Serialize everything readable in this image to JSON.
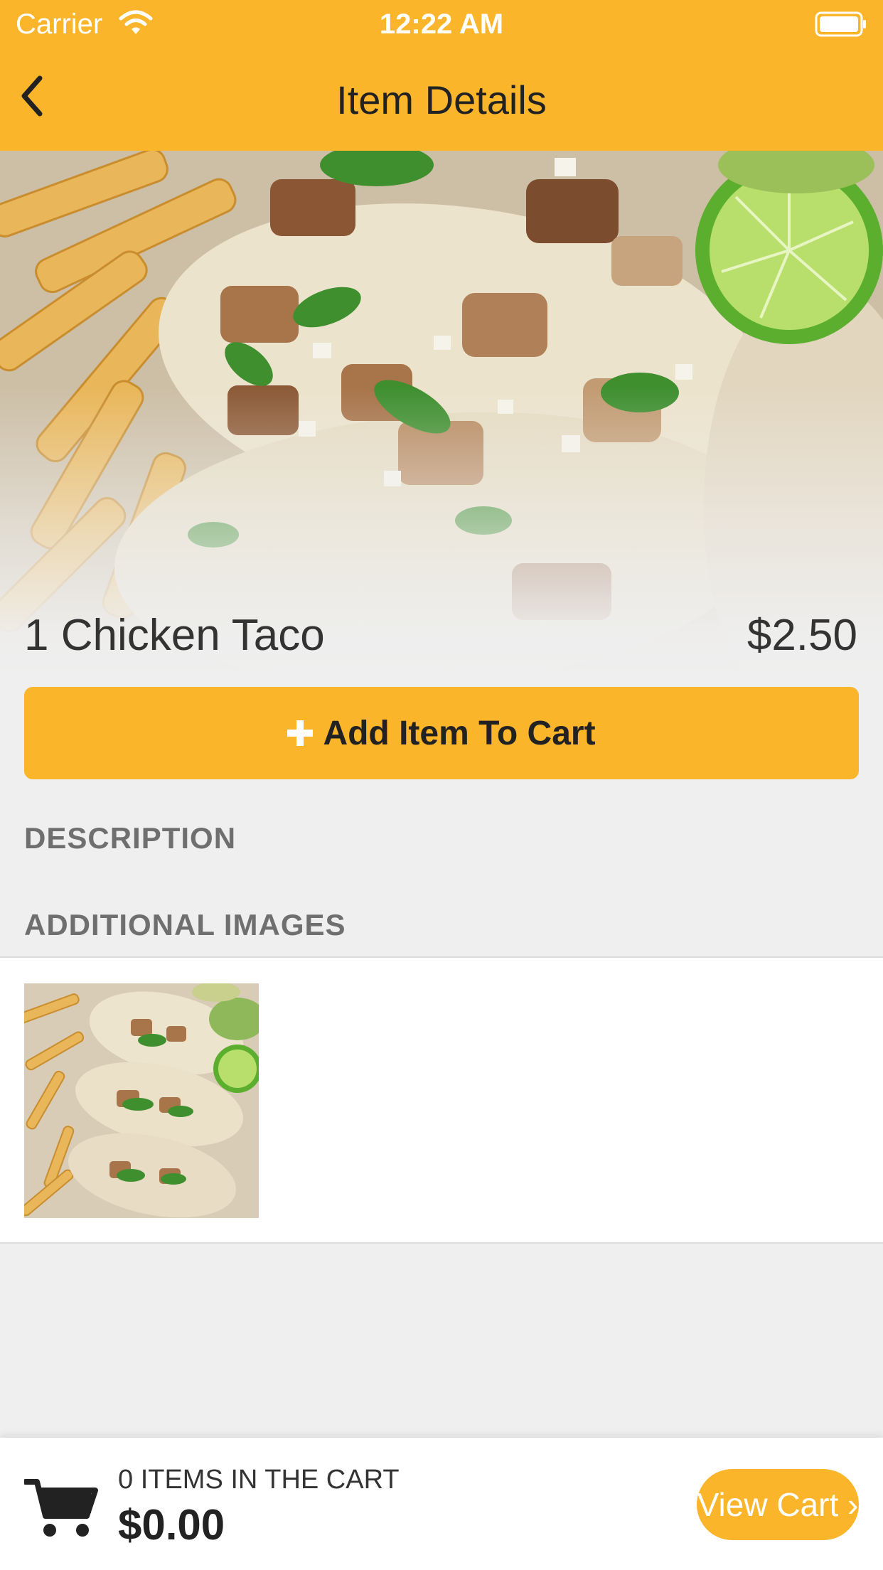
{
  "status_bar": {
    "carrier": "Carrier",
    "time": "12:22 AM"
  },
  "nav": {
    "title": "Item Details"
  },
  "item": {
    "name": "1 Chicken Taco",
    "price": "$2.50"
  },
  "actions": {
    "add_to_cart_label": "Add Item To Cart"
  },
  "sections": {
    "description": "DESCRIPTION",
    "additional_images": "ADDITIONAL IMAGES"
  },
  "cart": {
    "count_text": "0 ITEMS IN THE CART",
    "total": "$0.00",
    "view_cart_label": "View Cart ›"
  },
  "colors": {
    "accent": "#fbb52b",
    "background": "#efefef"
  },
  "icons": {
    "back": "chevron-left-icon",
    "cart": "cart-icon",
    "wifi": "wifi-icon",
    "battery": "battery-icon",
    "add": "plus-icon"
  }
}
